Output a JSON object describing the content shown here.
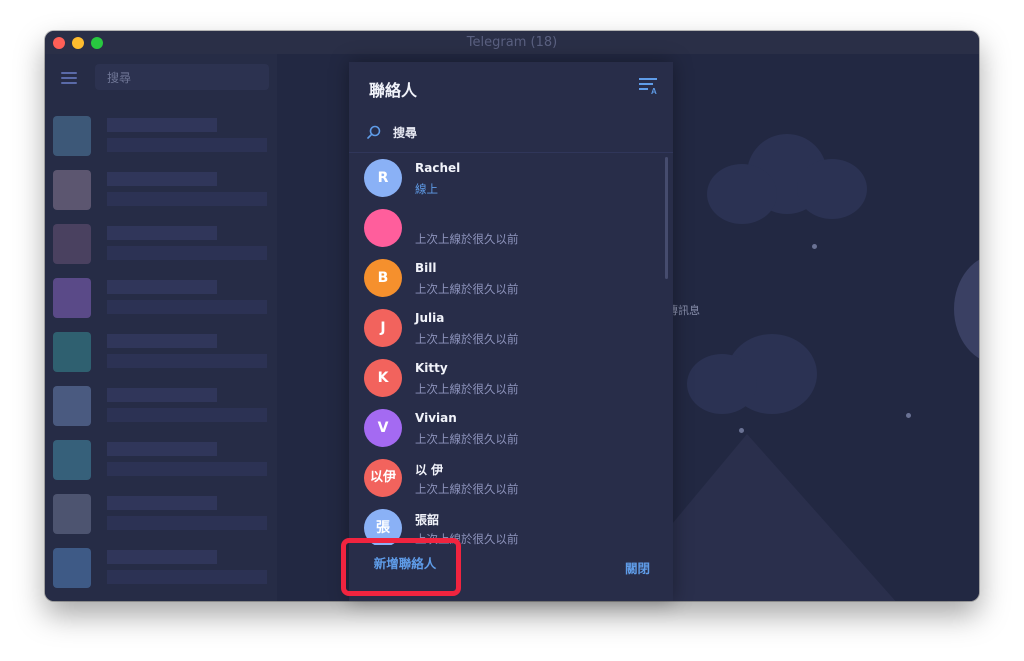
{
  "window": {
    "title": "Telegram (18)"
  },
  "sidebar": {
    "search_placeholder": "搜尋",
    "menu_icon": "hamburger-menu-icon"
  },
  "chat_area": {
    "hint_text": "傳訊息"
  },
  "contacts_dialog": {
    "title": "聯絡人",
    "sort_icon": "sort-by-name-icon",
    "search_icon": "search-icon",
    "search_placeholder": "搜尋",
    "contacts": [
      {
        "name": "Rachel",
        "status": "線上",
        "online": true,
        "initial": "R",
        "avatar_color": "#8ab1f6"
      },
      {
        "name": "",
        "status": "上次上線於很久以前",
        "online": false,
        "initial": "",
        "avatar_color": "#ff5e9c"
      },
      {
        "name": "Bill",
        "status": "上次上線於很久以前",
        "online": false,
        "initial": "B",
        "avatar_color": "#f5902d"
      },
      {
        "name": "Julia",
        "status": "上次上線於很久以前",
        "online": false,
        "initial": "J",
        "avatar_color": "#f2635d"
      },
      {
        "name": "Kitty",
        "status": "上次上線於很久以前",
        "online": false,
        "initial": "K",
        "avatar_color": "#f2635d"
      },
      {
        "name": "Vivian",
        "status": "上次上線於很久以前",
        "online": false,
        "initial": "V",
        "avatar_color": "#a46af2"
      },
      {
        "name": "以 伊",
        "status": "上次上線於很久以前",
        "online": false,
        "initial": "以伊",
        "avatar_color": "#f2635d"
      },
      {
        "name": "張韶",
        "status": "上次上線於很久以前",
        "online": false,
        "initial": "張",
        "avatar_color": "#8ab1f6"
      }
    ],
    "add_contact_label": "新增聯絡人",
    "close_label": "關閉"
  },
  "colors": {
    "accent": "#5f9ce8",
    "highlight_box": "#f0243f",
    "dialog_bg": "#282d49"
  }
}
